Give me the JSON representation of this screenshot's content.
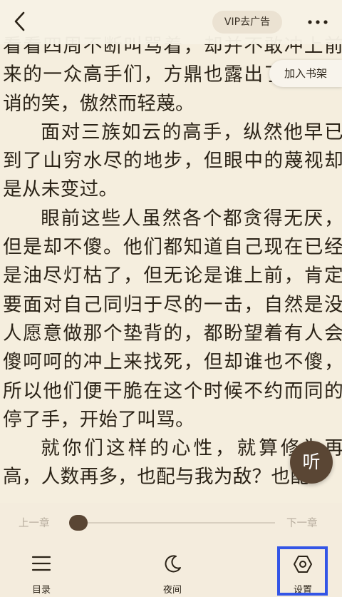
{
  "header": {
    "vip_label": "VIP去广告"
  },
  "floating": {
    "add_to_shelf": "加入书架",
    "listen": "听"
  },
  "content": {
    "paragraphs": [
      "看看四周不断叫骂着，却并不敢冲上前来的一众高手们，方鼎也露出了一抹讥诮的笑，傲然而轻蔑。",
      "面对三族如云的高手，纵然他早已到了山穷水尽的地步，但眼中的蔑视却是从未变过。",
      "眼前这些人虽然各个都贪得无厌，但是却不傻。他们都知道自己现在已经是油尽灯枯了，但无论是谁上前，肯定要面对自己同归于尽的一击，自然是没人愿意做那个垫背的，都盼望着有人会傻呵呵的冲上来找死，但却谁也不傻，所以他们便干脆在这个时候不约而同的停了手，开始了叫骂。",
      "就你们这样的心性，就算修为再高，人数再多，也配与我为敌？也配"
    ]
  },
  "progress": {
    "prev_label": "上一章",
    "next_label": "下一章",
    "position": 0.03
  },
  "nav": {
    "catalog": "目录",
    "night": "夜间",
    "settings": "设置"
  },
  "colors": {
    "page_bg": "#f5eede",
    "accent_brown": "#5a4634",
    "highlight_blue": "#3355e6"
  }
}
